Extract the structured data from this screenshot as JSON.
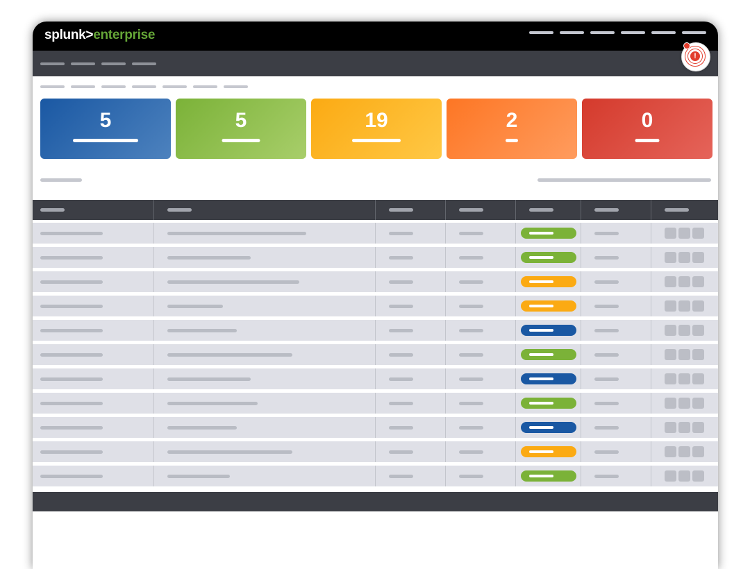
{
  "app": {
    "logo_primary": "splunk>",
    "logo_secondary": "enterprise",
    "alert_icon": "alert-icon",
    "alert_glyph": "!"
  },
  "colors": {
    "brand_green": "#65a637",
    "header_bg": "#000000",
    "nav_bg": "#3c3e45",
    "row_bg": "#dfe0e7",
    "status_green": "#7bb238",
    "status_yellow": "#fbaa13",
    "status_blue": "#1a58a3",
    "alert_red": "#e23e2e"
  },
  "summary_cards": [
    {
      "value": "5",
      "color": "blue"
    },
    {
      "value": "5",
      "color": "green"
    },
    {
      "value": "19",
      "color": "yellow"
    },
    {
      "value": "2",
      "color": "orange"
    },
    {
      "value": "0",
      "color": "red"
    }
  ],
  "table": {
    "rows": [
      {
        "status": "green"
      },
      {
        "status": "green"
      },
      {
        "status": "yellow"
      },
      {
        "status": "yellow"
      },
      {
        "status": "blue"
      },
      {
        "status": "green"
      },
      {
        "status": "blue"
      },
      {
        "status": "green"
      },
      {
        "status": "blue"
      },
      {
        "status": "yellow"
      },
      {
        "status": "green"
      }
    ]
  }
}
